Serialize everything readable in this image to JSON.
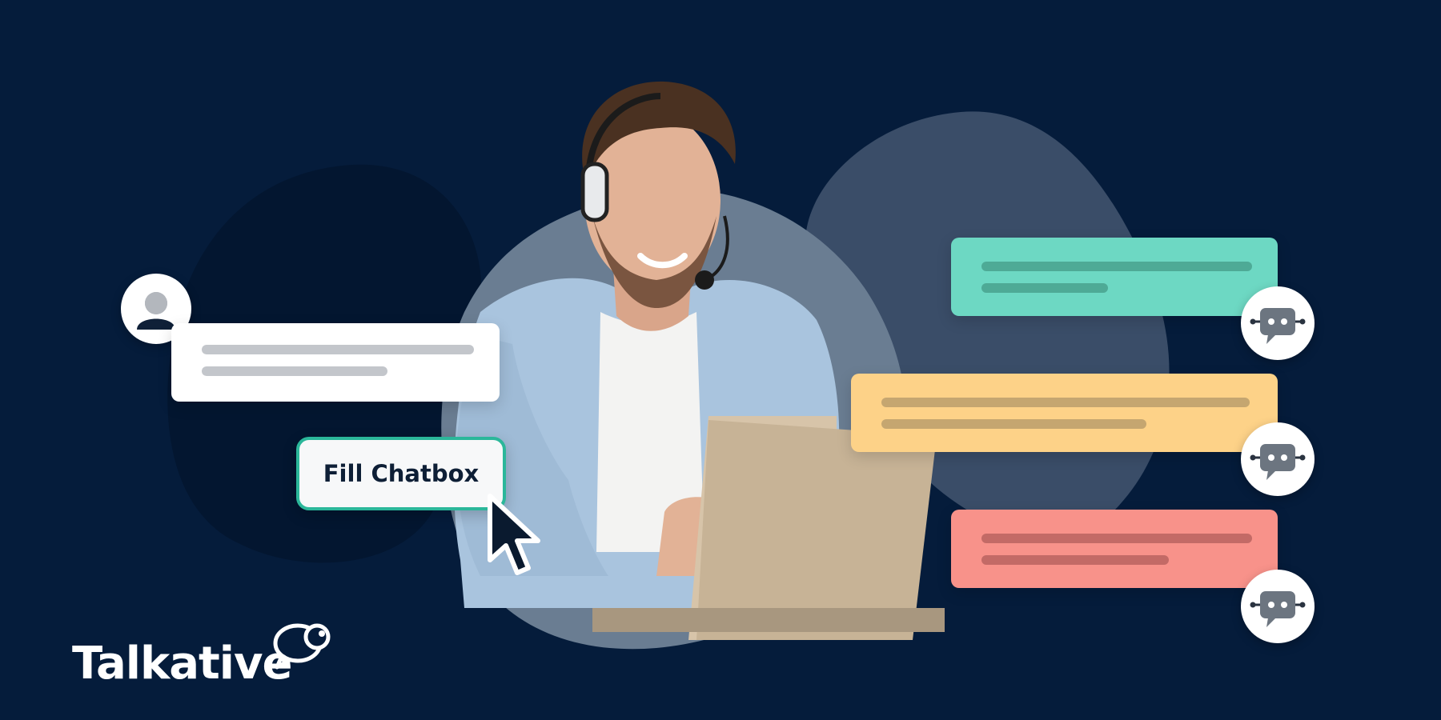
{
  "chat_button": {
    "label": "Fill Chatbox"
  },
  "brand": {
    "name": "Talkative"
  },
  "icons": {
    "customer": "user-avatar-icon",
    "bot": "chatbot-icon",
    "cursor": "mouse-cursor-icon",
    "logo": "chat-bubbles-logo-icon"
  },
  "colors": {
    "background": "#051c3b",
    "chip_border": "#2bb79a",
    "reply_teal": "#6dd8c3",
    "reply_yellow": "#fdd288",
    "reply_red": "#f8928a",
    "customer_bubble": "#ffffff"
  }
}
